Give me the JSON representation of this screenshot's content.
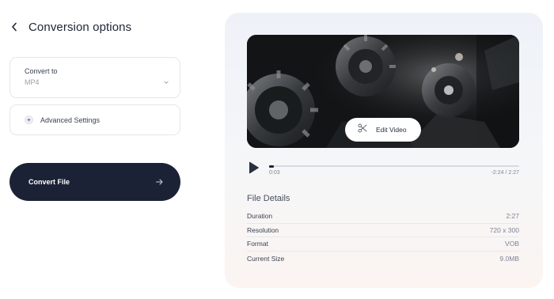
{
  "header": {
    "title": "Conversion options"
  },
  "convert_to": {
    "label": "Convert to",
    "value": "MP4"
  },
  "advanced": {
    "label": "Advanced Settings"
  },
  "convert_button": {
    "label": "Convert File"
  },
  "video": {
    "edit_label": "Edit Video",
    "current_time": "0:03",
    "remaining_total": "-2:24 / 2:27",
    "progress": 0.02
  },
  "file_details": {
    "title": "File Details",
    "rows": [
      {
        "key": "Duration",
        "value": "2:27"
      },
      {
        "key": "Resolution",
        "value": "720 x 300"
      },
      {
        "key": "Format",
        "value": "VOB"
      },
      {
        "key": "Current Size",
        "value": "9.0MB"
      }
    ]
  },
  "icons": {
    "back": "chevron-left-icon",
    "dropdown": "chevron-down-icon",
    "advanced": "plus-icon",
    "convert": "arrow-right-icon",
    "edit": "scissors-icon",
    "play": "play-icon"
  },
  "colors": {
    "primary_dark": "#1c2236",
    "panel_top": "#eef2f8",
    "panel_bottom": "#fbf4f1",
    "border": "#e4e6ec"
  }
}
